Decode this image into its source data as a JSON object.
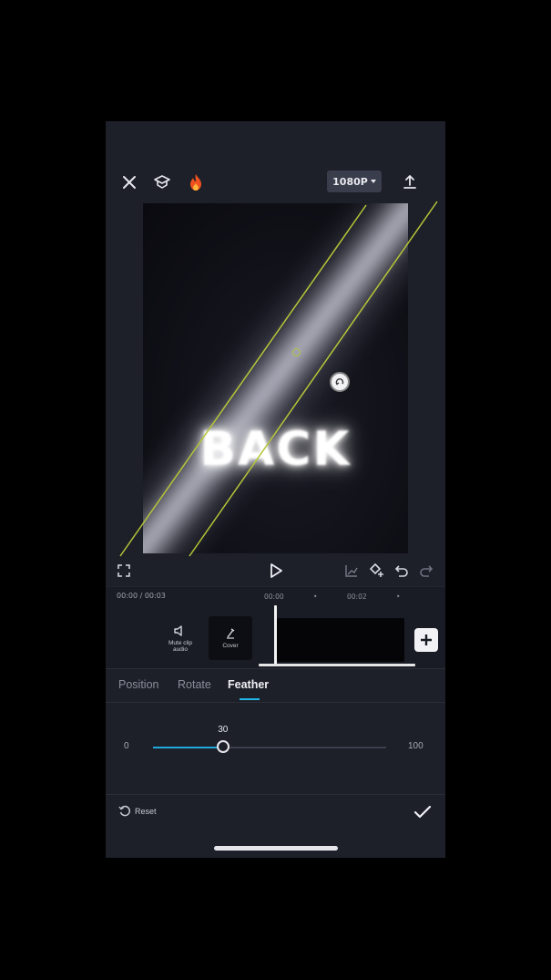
{
  "toolbar": {
    "close_icon": "close-icon",
    "tutorial_icon": "graduation-cap-icon",
    "trending_icon": "flame-icon",
    "resolution": "1080P",
    "export_icon": "export-icon"
  },
  "preview": {
    "text": "BACK",
    "mask_guide_color": "#b5c637"
  },
  "controls": {
    "fullscreen_icon": "fullscreen-icon",
    "play_icon": "play-icon",
    "keyframe_graph_icon": "keyframe-graph-icon",
    "keyframe_icon": "keyframe-icon",
    "undo_icon": "undo-icon",
    "redo_icon": "redo-icon"
  },
  "timeline": {
    "current_time": "00:00 / 00:03",
    "ticks": [
      "00:00",
      "•",
      "00:02",
      "•"
    ],
    "mute_label": "Mute clip audio",
    "cover_label": "Cover",
    "add_clip_icon": "plus-icon"
  },
  "tabs": [
    {
      "label": "Position",
      "active": false
    },
    {
      "label": "Rotate",
      "active": false
    },
    {
      "label": "Feather",
      "active": true
    }
  ],
  "slider": {
    "min": "0",
    "max": "100",
    "value": "30",
    "fraction": 0.3,
    "accent": "#1fa8d8"
  },
  "footer": {
    "reset_label": "Reset",
    "confirm_icon": "checkmark-icon"
  }
}
